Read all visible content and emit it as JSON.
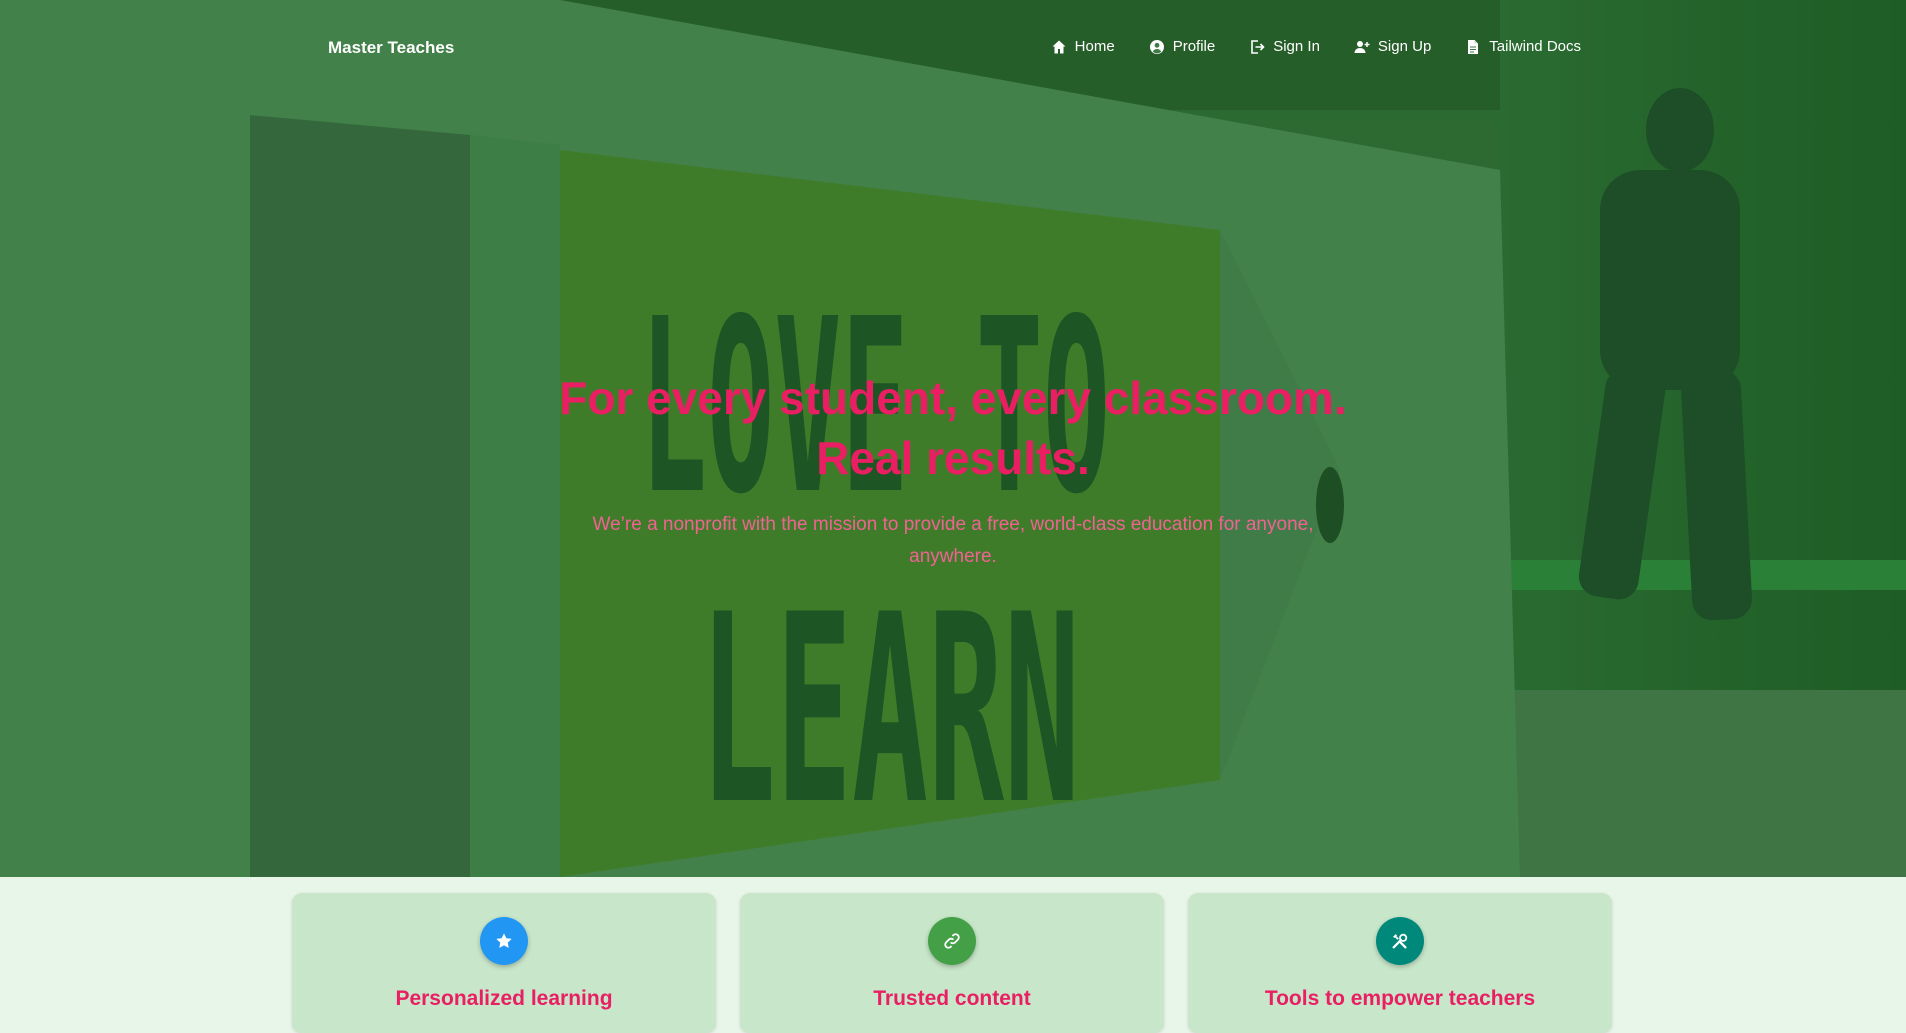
{
  "nav": {
    "brand": "Master Teaches",
    "items": [
      {
        "label": "Home",
        "icon": "home-icon"
      },
      {
        "label": "Profile",
        "icon": "user-circle-icon"
      },
      {
        "label": "Sign In",
        "icon": "sign-in-icon"
      },
      {
        "label": "Sign Up",
        "icon": "user-plus-icon"
      },
      {
        "label": "Tailwind Docs",
        "icon": "document-icon"
      }
    ]
  },
  "hero": {
    "title_line1": "For every student, every classroom.",
    "title_line2": "Real results.",
    "subtitle": "We’re a nonprofit with the mission to provide a free, world-class education for anyone, anywhere.",
    "background_sign_text": [
      "LOVE TO",
      "LEARN"
    ]
  },
  "features": [
    {
      "title": "Personalized learning",
      "icon": "star-icon",
      "color": "#2196f3"
    },
    {
      "title": "Trusted content",
      "icon": "link-icon",
      "color": "#43a047"
    },
    {
      "title": "Tools to empower teachers",
      "icon": "tools-icon",
      "color": "#00897b"
    }
  ],
  "colors": {
    "accent": "#e91e63",
    "subtitle": "#f06292",
    "page_bg": "#e8f5e9",
    "card_bg": "#c8e6c9"
  }
}
